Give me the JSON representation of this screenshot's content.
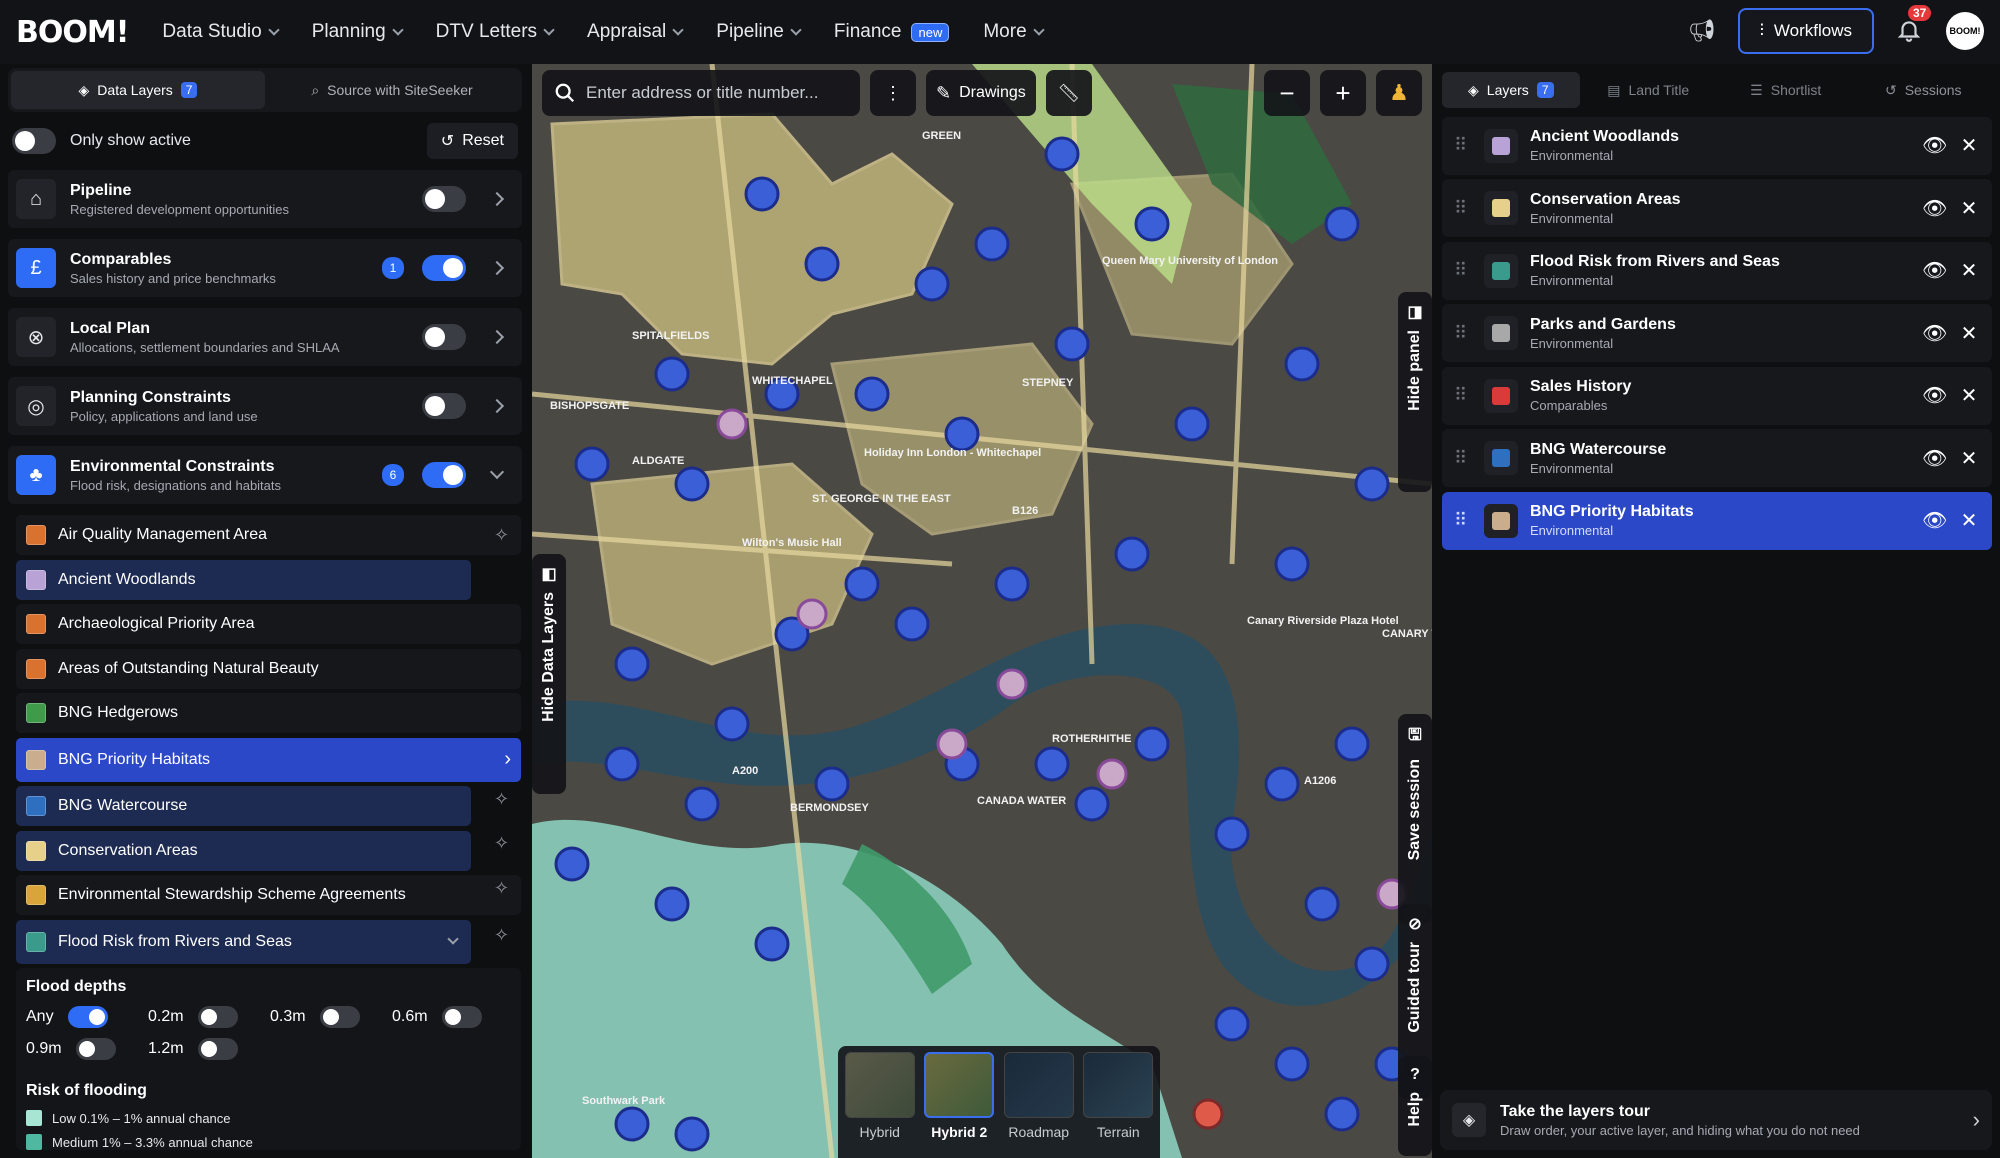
{
  "brand": {
    "logo": "BOOM!"
  },
  "nav": [
    {
      "label": "Data Studio"
    },
    {
      "label": "Planning"
    },
    {
      "label": "DTV Letters"
    },
    {
      "label": "Appraisal"
    },
    {
      "label": "Pipeline"
    },
    {
      "label": "Finance",
      "badge": "new"
    },
    {
      "label": "More"
    }
  ],
  "topright": {
    "workflows": "Workflows",
    "notifications": "37",
    "avatar": "BOOM!"
  },
  "left": {
    "tabs": [
      {
        "label": "Data Layers",
        "count": "7"
      },
      {
        "label": "Source with SiteSeeker"
      }
    ],
    "only_active": "Only show active",
    "reset": "Reset",
    "categories": [
      {
        "title": "Pipeline",
        "sub": "Registered development opportunities",
        "on": false
      },
      {
        "title": "Comparables",
        "sub": "Sales history and price benchmarks",
        "count": "1",
        "on": true
      },
      {
        "title": "Local Plan",
        "sub": "Allocations, settlement boundaries and SHLAA",
        "on": false
      },
      {
        "title": "Planning Constraints",
        "sub": "Policy, applications and land use",
        "on": false
      },
      {
        "title": "Environmental Constraints",
        "sub": "Flood risk, designations and habitats",
        "count": "6",
        "on": true
      }
    ],
    "layers": [
      {
        "label": "Air Quality Management Area",
        "color": "#d9722f"
      },
      {
        "label": "Ancient Woodlands",
        "color": "#b9a3d6"
      },
      {
        "label": "Archaeological Priority Area",
        "color": "#d9722f"
      },
      {
        "label": "Areas of Outstanding Natural Beauty",
        "color": "#d9722f"
      },
      {
        "label": "BNG Hedgerows",
        "color": "#3f9a4a"
      },
      {
        "label": "BNG Priority Habitats",
        "color": "#c9ad8c"
      },
      {
        "label": "BNG Watercourse",
        "color": "#2f6fc0"
      },
      {
        "label": "Conservation Areas",
        "color": "#e6d08a"
      },
      {
        "label": "Environmental Stewardship Scheme Agreements",
        "color": "#d9a53a"
      },
      {
        "label": "Flood Risk from Rivers and Seas",
        "color": "#3a9a8c"
      }
    ],
    "flood": {
      "depths_title": "Flood depths",
      "depths": [
        "Any",
        "0.2m",
        "0.3m",
        "0.6m",
        "0.9m",
        "1.2m"
      ],
      "risk_title": "Risk of flooding",
      "risk": [
        {
          "label": "Low 0.1% – 1% annual chance",
          "color": "#a8e6d4"
        },
        {
          "label": "Medium 1% – 3.3% annual chance",
          "color": "#4fb8a0"
        }
      ]
    }
  },
  "map": {
    "search_placeholder": "Enter address or title number...",
    "drawings": "Drawings",
    "hide_data_layers": "Hide Data Layers",
    "hide_panel": "Hide panel",
    "save_session": "Save session",
    "guided_tour": "Guided tour",
    "help": "Help",
    "basemaps": [
      {
        "label": "Hybrid"
      },
      {
        "label": "Hybrid 2",
        "selected": true
      },
      {
        "label": "Roadmap"
      },
      {
        "label": "Terrain"
      }
    ],
    "labels": [
      "SPITALFIELDS",
      "WHITECHAPEL",
      "BISHOPSGATE",
      "ALDGATE",
      "ST. GEORGE IN THE EAST",
      "Wilton's Music Hall",
      "STEPNEY",
      "BERMONDSEY",
      "CANADA WATER",
      "ROTHERHITHE",
      "B126",
      "A200",
      "A1206",
      "Canary Riverside Plaza Hotel",
      "CANARY WHARF",
      "Queen Mary University of London",
      "GREEN",
      "Holiday Inn London - Whitechapel",
      "Southwark Park"
    ]
  },
  "right": {
    "tabs": [
      {
        "label": "Layers",
        "count": "7"
      },
      {
        "label": "Land Title"
      },
      {
        "label": "Shortlist"
      },
      {
        "label": "Sessions"
      }
    ],
    "layers": [
      {
        "title": "Ancient Woodlands",
        "sub": "Environmental",
        "color": "#b9a3d6"
      },
      {
        "title": "Conservation Areas",
        "sub": "Environmental",
        "color": "#e6d08a"
      },
      {
        "title": "Flood Risk from Rivers and Seas",
        "sub": "Environmental",
        "color": "#3a9a8c"
      },
      {
        "title": "Parks and Gardens",
        "sub": "Environmental",
        "color": "#a8a8a8"
      },
      {
        "title": "Sales History",
        "sub": "Comparables",
        "color": "#d93a3a"
      },
      {
        "title": "BNG Watercourse",
        "sub": "Environmental",
        "color": "#2f6fc0"
      },
      {
        "title": "BNG Priority Habitats",
        "sub": "Environmental",
        "color": "#c9ad8c"
      }
    ],
    "tour": {
      "title": "Take the layers tour",
      "sub": "Draw order, your active layer, and hiding what you do not need"
    }
  }
}
